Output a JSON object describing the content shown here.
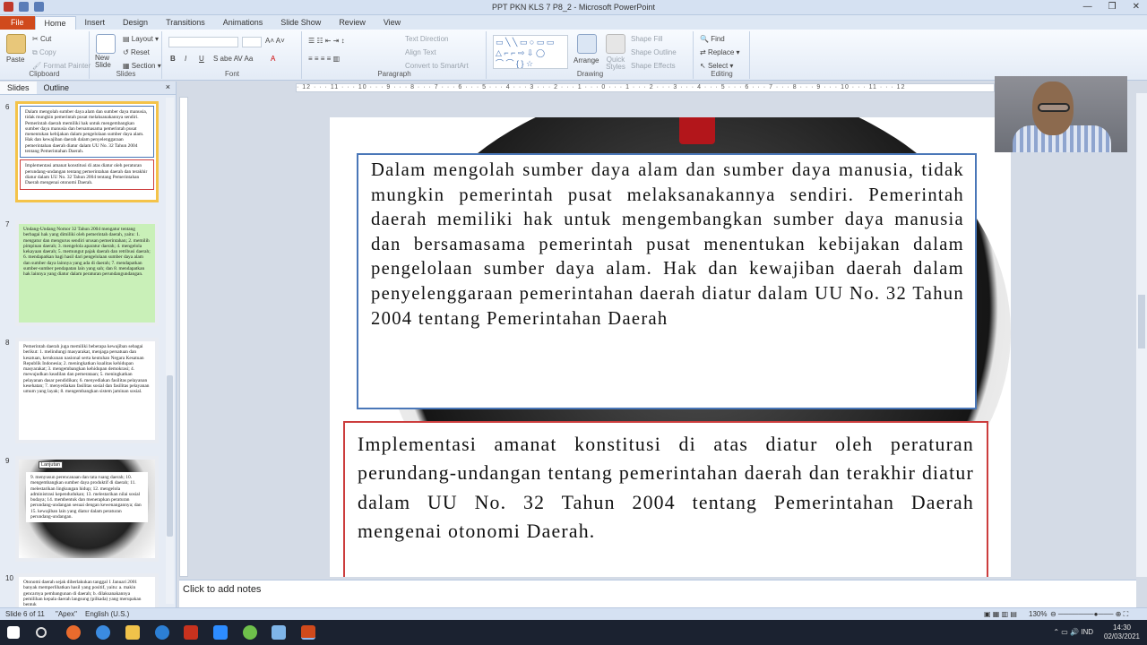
{
  "window": {
    "title": "PPT PKN KLS 7 P8_2 - Microsoft PowerPoint",
    "controls": [
      "—",
      "❒",
      "✕"
    ]
  },
  "ribbon_tabs": [
    "File",
    "Home",
    "Insert",
    "Design",
    "Transitions",
    "Animations",
    "Slide Show",
    "Review",
    "View"
  ],
  "ribbon": {
    "clipboard": {
      "label": "Clipboard",
      "paste": "Paste",
      "cut": "Cut",
      "copy": "Copy",
      "format_painter": "Format Painter"
    },
    "slides": {
      "label": "Slides",
      "new_slide": "New Slide",
      "layout": "Layout",
      "reset": "Reset",
      "section": "Section"
    },
    "font": {
      "label": "Font"
    },
    "paragraph": {
      "label": "Paragraph",
      "text_direction": "Text Direction",
      "align_text": "Align Text",
      "convert": "Convert to SmartArt"
    },
    "drawing": {
      "label": "Drawing",
      "arrange": "Arrange",
      "quick_styles": "Quick Styles",
      "shape_fill": "Shape Fill",
      "shape_outline": "Shape Outline",
      "shape_effects": "Shape Effects"
    },
    "editing": {
      "label": "Editing",
      "find": "Find",
      "replace": "Replace",
      "select": "Select"
    }
  },
  "pane": {
    "tabs": [
      "Slides",
      "Outline"
    ],
    "close": "×",
    "thumbnails": [
      {
        "num": "6",
        "selected": true,
        "text": "Dalam mengolah sumber daya alam dan sumber daya manusia, tidak mungkin pemerintah pusat melaksanakannya sendiri. Pemerintah daerah memiliki hak untuk mengembangkan sumber daya manusia dan bersamasama pemerintah pusat menentukan kebijakan dalam pengelolaan sumber daya alam. Hak dan kewajiban daerah dalam penyelenggaraan pemerintahan daerah diatur dalam UU No. 32 Tahun 2004 tentang Pemerintahan Daerah.",
        "text2": "Implementasi amanat konstitusi di atas diatur oleh peraturan perundang-undangan tentang pemerintahan daerah dan terakhir diatur dalam UU No. 32 Tahun 2004 tentang Pemerintahan Daerah mengenai otonomi Daerah."
      },
      {
        "num": "7",
        "selected": false,
        "text": "Undang-Undang Nomor 32 Tahun 2004 mengatur tentang berbagai hak yang dimiliki oleh pemerintah daerah, yaitu: 1. mengatur dan mengurus sendiri urusan pemerintahan; 2. memilih pimpinan daerah; 3. mengelola aparatur daerah; 4. mengelola kekayaan daerah; 5. memungut pajak daerah dan retribusi daerah; 6. mendapatkan bagi hasil dari pengelolaan sumber daya alam dan sumber daya lainnya yang ada di daerah; 7. mendapatkan sumber-sumber pendapatan lain yang sah; dan 8. mendapatkan hak lainnya yang diatur dalam peraturan perundangundangan."
      },
      {
        "num": "8",
        "selected": false,
        "text": "Pemerintah daerah juga memiliki beberapa kewajiban sebagai berikut: 1. melindungi masyarakat, menjaga persatuan dan kesatuan, kerukunan nasional serta keutuhan Negara Kesatuan Republik Indonesia; 2. meningkatkan kualitas kehidupan masyarakat; 3. mengembangkan kehidupan demokrasi; 4. mewujudkan keadilan dan pemerataan; 5. meningkatkan pelayanan dasar pendidikan; 6. menyediakan fasilitas pelayanan kesehatan; 7. menyediakan fasilitas sosial dan fasilitas pelayanan umum yang layak; 8. mengembangkan sistem jaminan sosial."
      },
      {
        "num": "9",
        "selected": false,
        "label": "Lanjutan",
        "text": "9. menyusun perencanaan dan tata ruang daerah; 10. mengembangkan sumber daya produktif di daerah; 11. melestarikan lingkungan hidup; 12. mengelola administrasi kependudukan; 13. melestarikan nilai sosial budaya; 14. membentuk dan menerapkan peraturan perundang-undangan sesuai dengan kewenangannya; dan 15. kewajiban lain yang diatur dalam peraturan perundang-undangan."
      },
      {
        "num": "10",
        "selected": false,
        "text": "Otonomi daerah sejak diberlakukan tanggal 1 Januari 2001 banyak memperlihatkan hasil yang positif, yaitu: a. makin gencarnya pembangunan di daerah; b. dilaksanakannya pemilihan kepala daerah langsung (pilkada) yang merupakan bentuk"
      }
    ]
  },
  "ruler": "· 12 · · · 11 · · · 10 · · · 9 · · · 8 · · · 7 · · · 6 · · · 5 · · · 4 · · · 3 · · · 2 · · · 1 · · · 0 · · · 1 · · · 2 · · · 3 · · · 4 · · · 5 · · · 6 · · · 7 · · · 8 · · · 9 · · · 10 · · · 11 · · · 12",
  "slide": {
    "box1": "Dalam mengolah sumber daya alam dan sumber daya manusia, tidak mungkin pemerintah pusat melaksanakannya sendiri. Pemerintah daerah memiliki hak untuk mengembangkan sumber daya manusia dan bersamasama pemerintah pusat menentukan kebijakan dalam pengelolaan sumber daya alam. Hak dan kewajiban daerah dalam penyelenggaraan pemerintahan daerah diatur dalam UU No. 32 Tahun 2004 tentang Pemerintahan Daerah",
    "box2": "Implementasi amanat konstitusi di atas diatur oleh peraturan perundang-undangan tentang pemerintahan daerah dan terakhir diatur dalam UU No. 32 Tahun 2004 tentang Pemerintahan Daerah mengenai otonomi Daerah."
  },
  "notes": {
    "placeholder": "Click to add notes"
  },
  "status": {
    "slide_info": "Slide 6 of 11",
    "theme": "\"Apex\"",
    "language": "English (U.S.)",
    "zoom": "130%"
  },
  "taskbar": {
    "time": "14:30",
    "date": "02/03/2021",
    "lang": "IND"
  },
  "colors": {
    "file_tab": "#d04a1c",
    "blue_border": "#4a77b8",
    "red_border": "#cc3d3d",
    "selected_thumb": "#f4c349"
  }
}
